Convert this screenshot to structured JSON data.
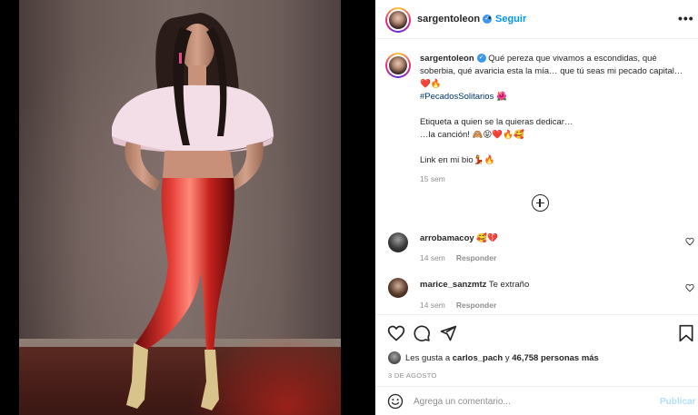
{
  "header": {
    "username": "sargentoleon",
    "separator": "•",
    "follow_label": "Seguir",
    "more_label": "•••"
  },
  "caption": {
    "username": "sargentoleon",
    "line1": "Qué pereza que vivamos a escondidas, qué soberbia, qué avaricia esta la mía… que tú seas mi pecado capital…",
    "line1_emoji": "❤️🔥",
    "hashtag": "#PecadosSolitarios",
    "hashtag_emoji": "🌺",
    "line2": "Etiqueta a quien se la quieras dedicar…",
    "line3": "…la canción! 🙈😝❤️🔥🥰",
    "line4": "Link en mi bio💃🔥",
    "time": "15 sem"
  },
  "comments": [
    {
      "username": "arrobamacoy",
      "text": "🥰💔",
      "time": "14 sem",
      "reply_label": "Responder"
    },
    {
      "username": "marice_sanzmtz",
      "text": "Te extraño",
      "time": "14 sem",
      "reply_label": "Responder"
    }
  ],
  "likes": {
    "prefix": "Les gusta a ",
    "user": "carlos_pach",
    "middle": " y ",
    "count": "46,758 personas más"
  },
  "date": "3 DE AGOSTO",
  "add_comment": {
    "placeholder": "Agrega un comentario...",
    "post_label": "Publicar"
  },
  "colors": {
    "accent": "#0095f6",
    "verified": "#3897f0",
    "hashtag": "#00376b",
    "muted": "#8e8e8e"
  }
}
